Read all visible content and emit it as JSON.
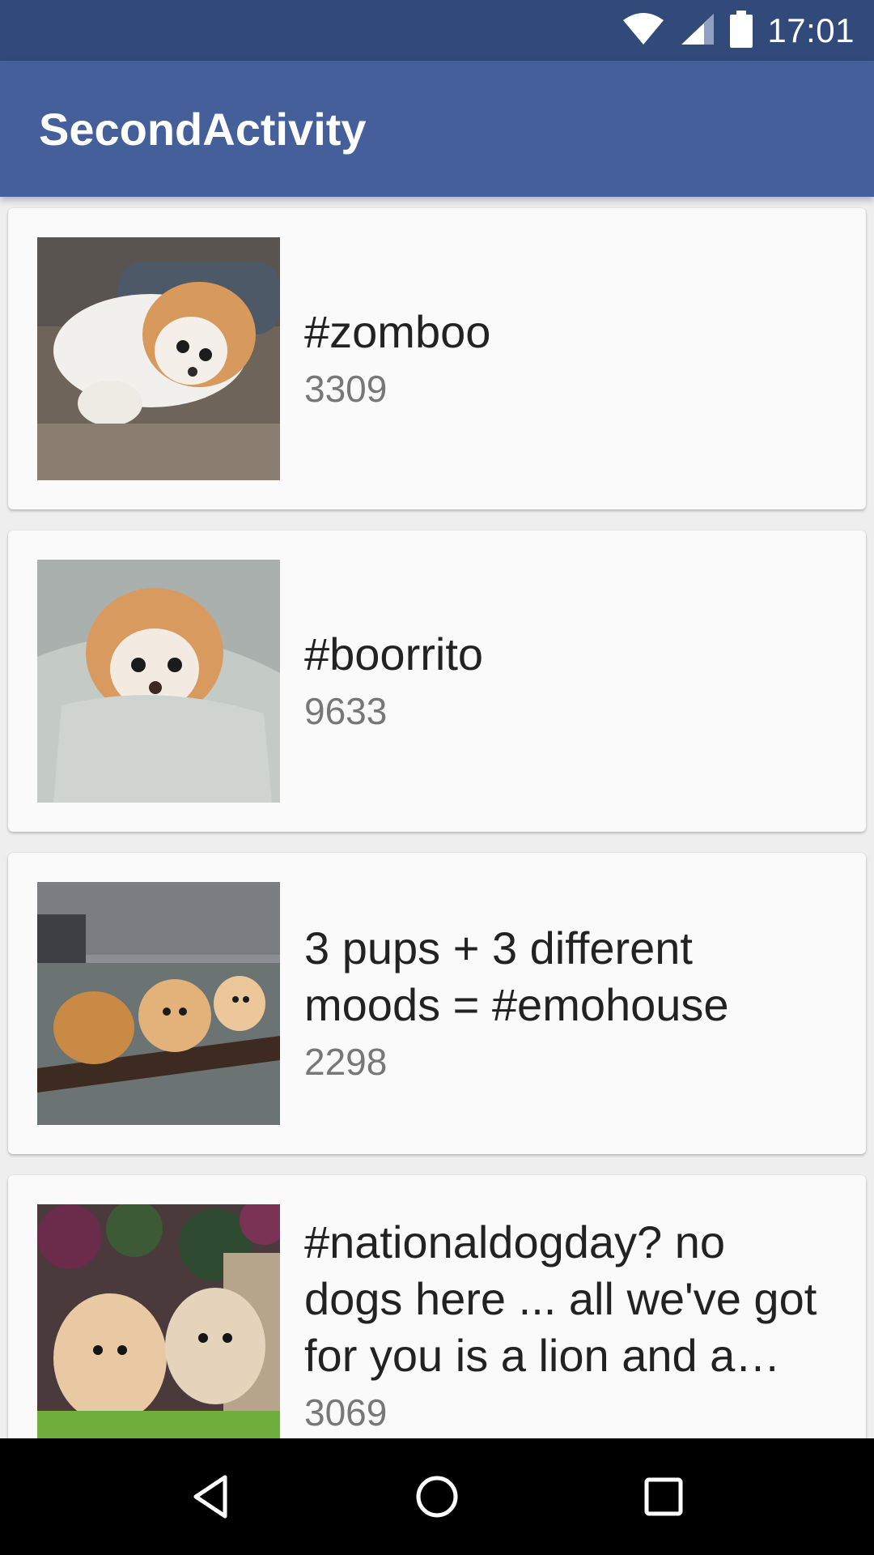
{
  "status_bar": {
    "time": "17:01",
    "icons": [
      "wifi-icon",
      "cellular-signal-icon",
      "battery-icon"
    ]
  },
  "app_bar": {
    "title": "SecondActivity"
  },
  "feed": {
    "items": [
      {
        "title": "#zomboo",
        "count": "3309",
        "image": "pomeranian-lying-on-couch"
      },
      {
        "title": "#boorrito",
        "count": "9633",
        "image": "pomeranian-wrapped-in-blanket"
      },
      {
        "title": "3 pups + 3 different moods = #emohouse",
        "count": "2298",
        "image": "three-dogs-on-rug"
      },
      {
        "title": "#nationaldogday?  no dogs here ... all we've got for you is a lion and a pomeranian",
        "count": "3069",
        "image": "two-pomeranians-in-grass"
      }
    ]
  },
  "nav_bar": {
    "icons": [
      "back-icon",
      "home-icon",
      "recents-icon"
    ]
  },
  "colors": {
    "status_bar": "#314a7a",
    "app_bar": "#445f99",
    "card": "#fafafa",
    "background": "#eeeeee"
  }
}
